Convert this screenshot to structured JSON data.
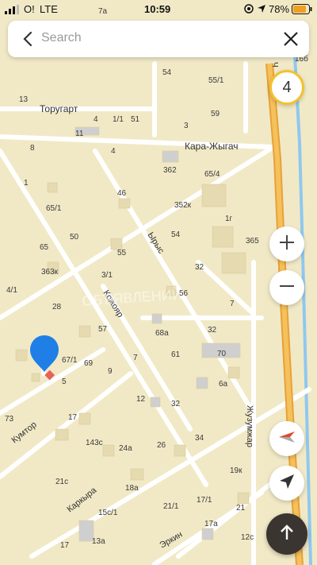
{
  "status_bar": {
    "carrier": "O!",
    "network": "LTE",
    "time": "10:59",
    "battery": "78%"
  },
  "search": {
    "placeholder": "Search"
  },
  "traffic": {
    "level": "4"
  },
  "map": {
    "streets": {
      "torugart": "Торугарт",
      "kara_zhygach": "Кара-Жыгач",
      "yrys": "Ырыс",
      "kozhoyar": "Кожояр",
      "kumtor": "Кумтор",
      "karkyra": "Каркыра",
      "erkin": "Эркин",
      "zhuzumzhar": "Жузумжар",
      "ch": "Ч"
    },
    "watermark": "ОБЪЯВЛЕНИЙ",
    "house_numbers": [
      "7а",
      "16б",
      "54",
      "55/1",
      "13",
      "59",
      "1/1",
      "4",
      "51",
      "3",
      "11",
      "8",
      "4",
      "362",
      "65/4",
      "1",
      "46",
      "352к",
      "1г",
      "65/1",
      "50",
      "54",
      "365",
      "65",
      "55",
      "32",
      "363к",
      "3/1",
      "56",
      "28",
      "4/1",
      "7",
      "57",
      "68а",
      "32",
      "67/1",
      "7",
      "61",
      "70",
      "69",
      "5",
      "9",
      "6а",
      "73",
      "17",
      "12",
      "32",
      "34",
      "143с",
      "24а",
      "26",
      "19к",
      "21с",
      "18а",
      "21/1",
      "17/1",
      "21",
      "15с/1",
      "17а",
      "12с",
      "13а",
      "17",
      "8"
    ]
  },
  "accent_colors": {
    "pin": "#1f7fe6",
    "highway": "#f3b03b",
    "river": "#8fc8f0",
    "traffic_ring": "#f2c230",
    "route_button": "#3a3530",
    "compass": "#e04a2a"
  },
  "icons": {
    "back": "back-arrow-icon",
    "close": "close-icon",
    "zoom_in": "plus-icon",
    "zoom_out": "minus-icon",
    "compass": "compass-icon",
    "locate": "location-arrow-icon",
    "route": "route-arrow-icon"
  }
}
